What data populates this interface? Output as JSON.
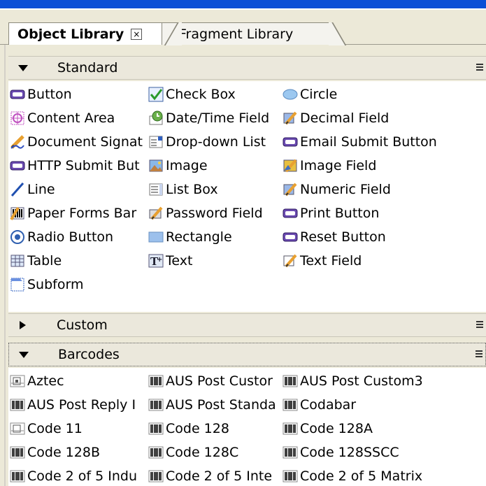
{
  "tabs": [
    {
      "label": "Object Library",
      "active": true
    },
    {
      "label": "Fragment Library",
      "active": false
    }
  ],
  "close_glyph": "×",
  "sections": {
    "standard": {
      "title": "Standard",
      "expanded": true,
      "items": [
        {
          "label": "Button",
          "icon": "button-icon"
        },
        {
          "label": "Check Box",
          "icon": "check-box-icon"
        },
        {
          "label": "Circle",
          "icon": "circle-icon"
        },
        {
          "label": "Content Area",
          "icon": "content-area-icon"
        },
        {
          "label": "Date/Time Field",
          "icon": "date-time-field-icon"
        },
        {
          "label": "Decimal Field",
          "icon": "decimal-field-icon"
        },
        {
          "label": "Document Signat",
          "icon": "document-signature-icon"
        },
        {
          "label": "Drop-down List",
          "icon": "drop-down-list-icon"
        },
        {
          "label": "Email Submit Button",
          "icon": "email-submit-button-icon"
        },
        {
          "label": "HTTP Submit But",
          "icon": "http-submit-button-icon"
        },
        {
          "label": "Image",
          "icon": "image-icon"
        },
        {
          "label": "Image Field",
          "icon": "image-field-icon"
        },
        {
          "label": "Line",
          "icon": "line-icon"
        },
        {
          "label": "List Box",
          "icon": "list-box-icon"
        },
        {
          "label": "Numeric Field",
          "icon": "numeric-field-icon"
        },
        {
          "label": "Paper Forms Bar",
          "icon": "paper-forms-barcode-icon"
        },
        {
          "label": "Password Field",
          "icon": "password-field-icon"
        },
        {
          "label": "Print Button",
          "icon": "print-button-icon"
        },
        {
          "label": "Radio Button",
          "icon": "radio-button-icon"
        },
        {
          "label": "Rectangle",
          "icon": "rectangle-icon"
        },
        {
          "label": "Reset Button",
          "icon": "reset-button-icon"
        },
        {
          "label": "Table",
          "icon": "table-icon"
        },
        {
          "label": "Text",
          "icon": "text-icon"
        },
        {
          "label": "Text Field",
          "icon": "text-field-icon"
        },
        {
          "label": "Subform",
          "icon": "subform-icon"
        }
      ]
    },
    "custom": {
      "title": "Custom",
      "expanded": false
    },
    "barcodes": {
      "title": "Barcodes",
      "expanded": true,
      "items": [
        {
          "label": "Aztec",
          "icon": "aztec-barcode-icon"
        },
        {
          "label": "AUS Post Custor",
          "icon": "barcode-icon"
        },
        {
          "label": "AUS Post Custom3",
          "icon": "barcode-icon"
        },
        {
          "label": "AUS Post Reply I",
          "icon": "barcode-icon"
        },
        {
          "label": "AUS Post Standa",
          "icon": "barcode-icon"
        },
        {
          "label": "Codabar",
          "icon": "barcode-icon"
        },
        {
          "label": "Code 11",
          "icon": "code11-barcode-icon"
        },
        {
          "label": "Code 128",
          "icon": "barcode-icon"
        },
        {
          "label": "Code 128A",
          "icon": "barcode-icon"
        },
        {
          "label": "Code 128B",
          "icon": "barcode-icon"
        },
        {
          "label": "Code 128C",
          "icon": "barcode-icon"
        },
        {
          "label": "Code 128SSCC",
          "icon": "barcode-icon"
        },
        {
          "label": "Code 2 of 5 Indu",
          "icon": "barcode-icon"
        },
        {
          "label": "Code 2 of 5 Inte",
          "icon": "barcode-icon"
        },
        {
          "label": "Code 2 of 5 Matrix",
          "icon": "barcode-icon"
        }
      ]
    }
  },
  "colors": {
    "title_bar_blue": "#0b4fd6",
    "panel_bg": "#ece9d8",
    "button_purple": "#5a3a9a"
  }
}
